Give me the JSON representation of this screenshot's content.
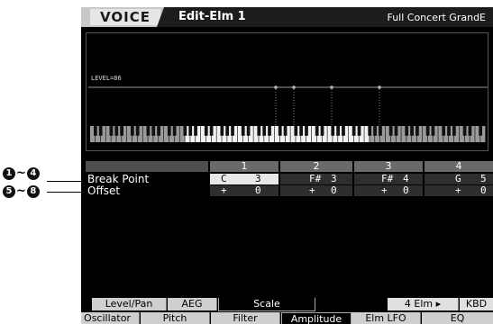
{
  "title_bar": {
    "mode": "VOICE",
    "edit_title": "Edit-Elm 1",
    "voice_name": "Full Concert GrandE"
  },
  "graph": {
    "level_label": "LEVEL=86"
  },
  "table": {
    "columns": [
      "1",
      "2",
      "3",
      "4"
    ],
    "rows": [
      {
        "label": "Break Point",
        "cells": [
          [
            "C",
            "3"
          ],
          [
            "F#",
            "3"
          ],
          [
            "F#",
            "4"
          ],
          [
            "G",
            "5"
          ]
        ]
      },
      {
        "label": "Offset",
        "cells": [
          [
            "+",
            "0"
          ],
          [
            "+",
            "0"
          ],
          [
            "+",
            "0"
          ],
          [
            "+",
            "0"
          ]
        ]
      }
    ]
  },
  "tabs_upper": [
    "Level/Pan",
    "AEG",
    "Scale",
    "4 Elm ▸",
    "KBD"
  ],
  "tabs_lower": [
    "Oscillator",
    "Pitch",
    "Filter",
    "Amplitude",
    "Elm LFO",
    "EQ"
  ],
  "callouts": [
    {
      "from": "1",
      "to": "4"
    },
    {
      "from": "5",
      "to": "8"
    }
  ]
}
